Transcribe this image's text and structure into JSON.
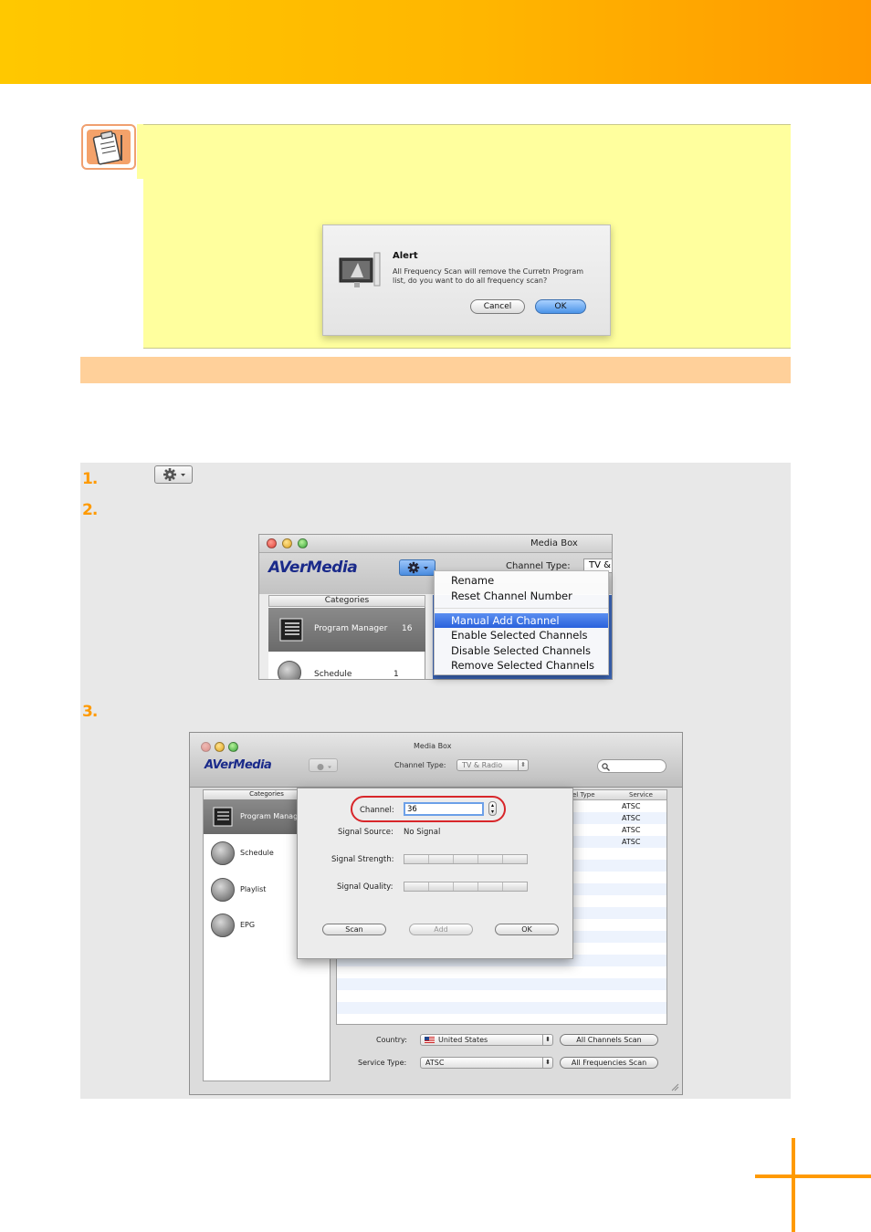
{
  "alert": {
    "title": "Alert",
    "message": "All Frequency Scan will remove the Curretn Program list, do you want to do all frequency scan?",
    "cancel_label": "Cancel",
    "ok_label": "OK"
  },
  "steps": {
    "step1": "1.",
    "step2": "2.",
    "step3": "3."
  },
  "menu_screenshot": {
    "window_title": "Media Box",
    "logo": "AVerMedia",
    "channel_type_label": "Channel Type:",
    "channel_type_value": "TV &",
    "categories_header": "Categories",
    "categories": [
      {
        "label": "Program Manager",
        "count": "16"
      },
      {
        "label": "Schedule",
        "count": "1"
      }
    ],
    "menu_items": [
      "Rename",
      "Reset Channel Number",
      "Manual Add Channel",
      "Enable Selected Channels",
      "Disable Selected Channels",
      "Remove Selected Channels"
    ]
  },
  "dialog_screenshot": {
    "window_title": "Media Box",
    "logo": "AVerMedia",
    "channel_type_label": "Channel Type:",
    "channel_type_value": "TV & Radio",
    "categories_header": "Categories",
    "sidebar": [
      "Program Manage",
      "Schedule",
      "Playlist",
      "EPG"
    ],
    "table_headers": [
      "el Type",
      "Service"
    ],
    "services": [
      "ATSC",
      "ATSC",
      "ATSC",
      "ATSC"
    ],
    "dialog": {
      "channel_label": "Channel:",
      "channel_value": "36",
      "signal_source_label": "Signal Source:",
      "signal_source_value": "No Signal",
      "signal_strength_label": "Signal Strength:",
      "signal_quality_label": "Signal Quality:",
      "scan_label": "Scan",
      "add_label": "Add",
      "ok_label": "OK"
    },
    "country_label": "Country:",
    "country_value": "United States",
    "service_type_label": "Service Type:",
    "service_type_value": "ATSC",
    "all_channels_scan": "All Channels Scan",
    "all_frequencies_scan": "All Frequencies Scan"
  },
  "colors": {
    "accent_orange": "#ff9a00",
    "note_yellow": "#ffff9e",
    "section_bar": "#ffd09a",
    "highlight_red": "#d8262a"
  }
}
